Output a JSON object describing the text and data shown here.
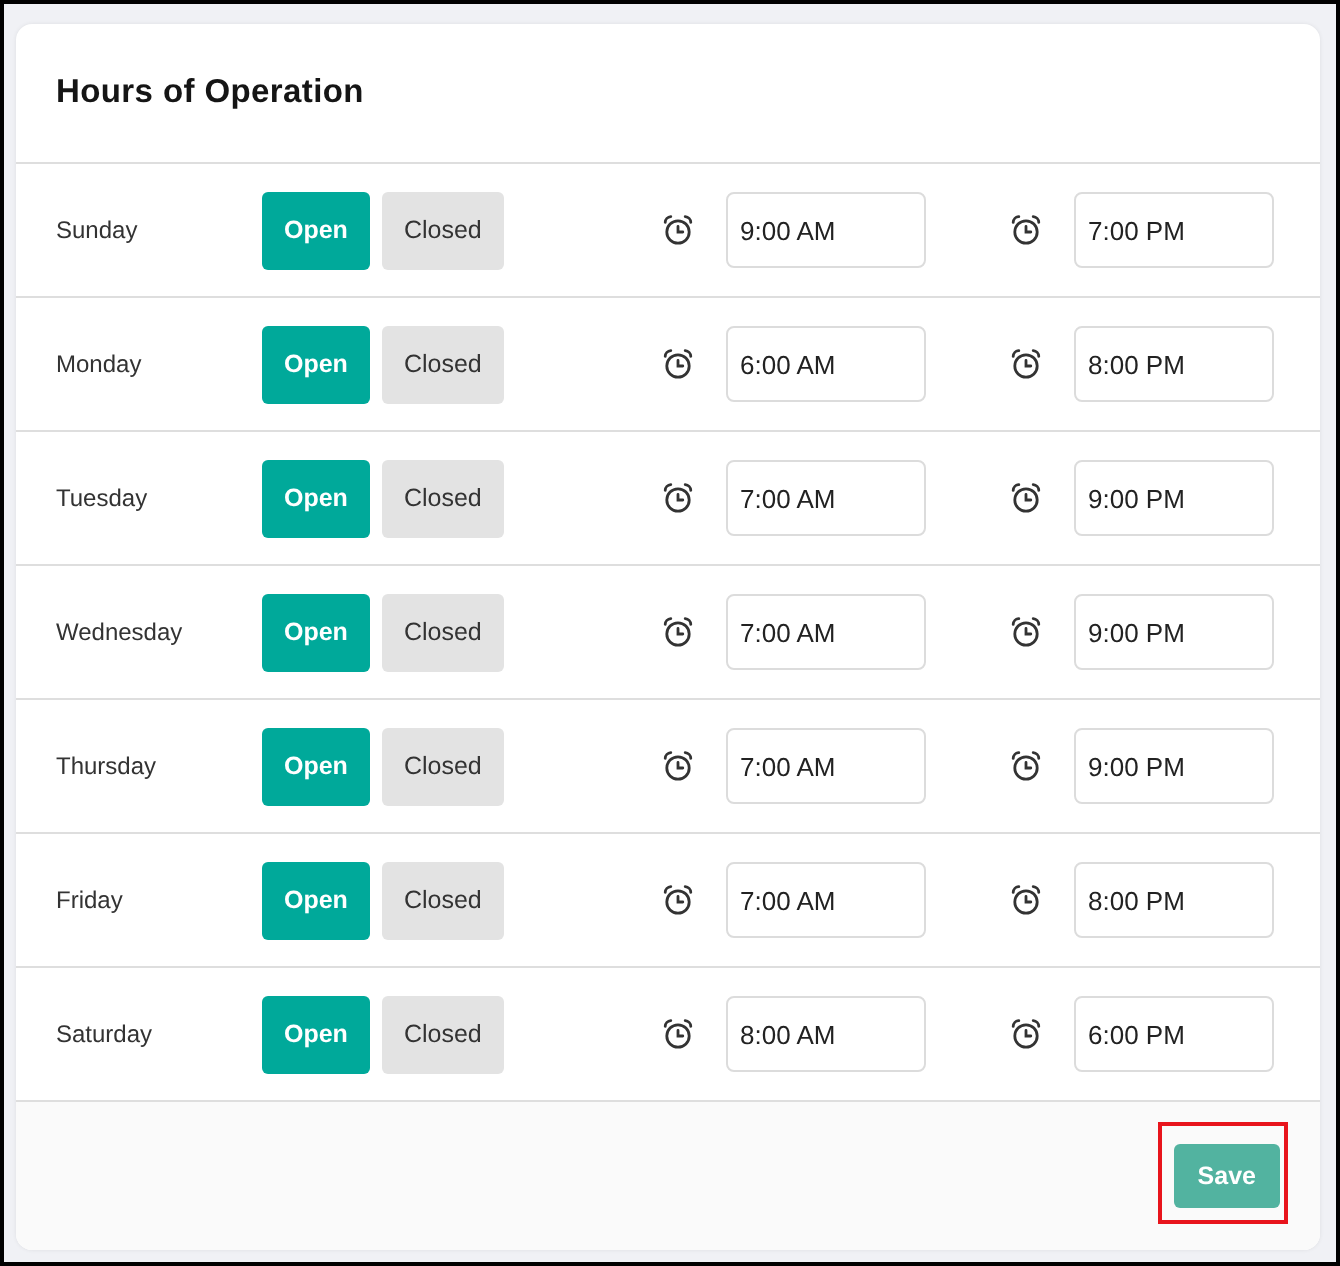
{
  "card": {
    "title": "Hours of Operation"
  },
  "days": [
    {
      "name": "Sunday",
      "options": [
        {
          "label": "Open",
          "selected": true
        },
        {
          "label": "Closed",
          "selected": false
        }
      ],
      "open_time": "9:00 AM",
      "close_time": "7:00 PM"
    },
    {
      "name": "Monday",
      "options": [
        {
          "label": "Open",
          "selected": true
        },
        {
          "label": "Closed",
          "selected": false
        }
      ],
      "open_time": "6:00 AM",
      "close_time": "8:00 PM"
    },
    {
      "name": "Tuesday",
      "options": [
        {
          "label": "Open",
          "selected": true
        },
        {
          "label": "Closed",
          "selected": false
        }
      ],
      "open_time": "7:00 AM",
      "close_time": "9:00 PM"
    },
    {
      "name": "Wednesday",
      "options": [
        {
          "label": "Open",
          "selected": true
        },
        {
          "label": "Closed",
          "selected": false
        }
      ],
      "open_time": "7:00 AM",
      "close_time": "9:00 PM"
    },
    {
      "name": "Thursday",
      "options": [
        {
          "label": "Open",
          "selected": true
        },
        {
          "label": "Closed",
          "selected": false
        }
      ],
      "open_time": "7:00 AM",
      "close_time": "9:00 PM"
    },
    {
      "name": "Friday",
      "options": [
        {
          "label": "Open",
          "selected": true
        },
        {
          "label": "Closed",
          "selected": false
        }
      ],
      "open_time": "7:00 AM",
      "close_time": "8:00 PM"
    },
    {
      "name": "Saturday",
      "options": [
        {
          "label": "Open",
          "selected": true
        },
        {
          "label": "Closed",
          "selected": false
        }
      ],
      "open_time": "8:00 AM",
      "close_time": "6:00 PM"
    }
  ],
  "footer": {
    "save_button": {
      "label": "Save",
      "highlighted": true
    }
  }
}
